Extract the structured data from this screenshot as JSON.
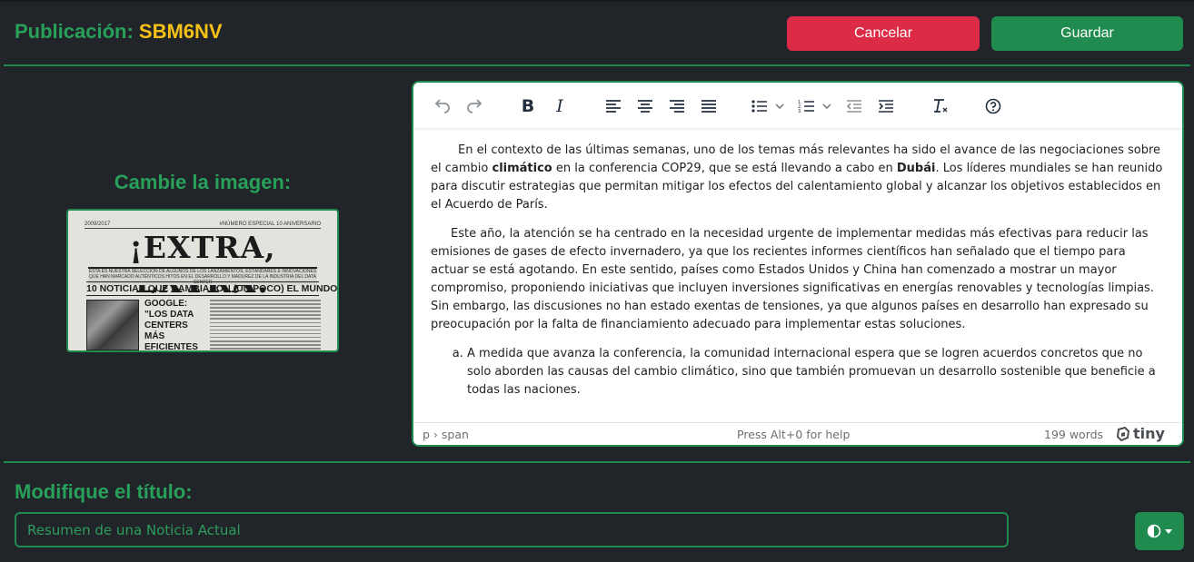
{
  "header": {
    "label": "Publicación:",
    "code": "SBM6NV",
    "cancel_label": "Cancelar",
    "save_label": "Guardar"
  },
  "image_section": {
    "label": "Cambie la imagen:",
    "newspaper": {
      "date": "2009/2017",
      "edition": "#NÚMERO ESPECIAL 10 ANIVERSARIO",
      "headline": "¡EXTRA, EXTRA!",
      "subheadline": "ESTA ES NUESTRA SELECCIÓN DE ALGUNOS DE LOS LANZAMIENTOS, ESTÁNDARES E INNOVACIONES QUE HAN MARCADO AUTÉNTICOS HITOS EN EL DESARROLLO Y MADUREZ DE LA INDUSTRIA DEL DATA CENTER",
      "banner": "10 NOTICIAS QUE CAMBIARON (UN POCO) EL MUNDO",
      "story": "GOOGLE: \"LOS DATA CENTERS MÁS EFICIENTES DEL GLOBO\""
    }
  },
  "editor": {
    "toolbar": {
      "icons": [
        "undo-icon",
        "redo-icon",
        "bold-icon",
        "italic-icon",
        "align-left-icon",
        "align-center-icon",
        "align-right-icon",
        "align-justify-icon",
        "bullet-list-icon",
        "numbered-list-icon",
        "outdent-icon",
        "indent-icon",
        "clear-formatting-icon",
        "help-icon"
      ]
    },
    "paragraph1": {
      "part1": "En el contexto de las últimas semanas, uno de los temas más relevantes ha sido el avance de las negociaciones sobre el cambio ",
      "bold1": "climático",
      "part2": " en la conferencia COP29, que se está llevando a cabo en ",
      "bold2": "Dubái",
      "part3": ". Los líderes mundiales se han reunido para discutir estrategias que permitan mitigar los efectos del calentamiento global y alcanzar los objetivos establecidos en el Acuerdo de París."
    },
    "paragraph2": "Este año, la atención se ha centrado en la necesidad urgente de implementar medidas más efectivas para reducir las emisiones de gases de efecto invernadero, ya que los recientes informes científicos han señalado que el tiempo para actuar se está agotando. En este sentido, países como Estados Unidos y China han comenzado a mostrar un mayor compromiso, proponiendo iniciativas que incluyen inversiones significativas en energías renovables y tecnologías limpias. Sin embargo, las discusiones no han estado exentas de tensiones, ya que algunos países en desarrollo han expresado su preocupación por la falta de financiamiento adecuado para implementar estas soluciones.",
    "list_items": [
      "A medida que avanza la conferencia, la comunidad internacional espera que se logren acuerdos concretos que no solo aborden las causas del cambio climático, sino que también promuevan un desarrollo sostenible que beneficie a todas las naciones."
    ],
    "status": {
      "path": "p › span",
      "help": "Press Alt+0 for help",
      "words": "199 words",
      "brand": "tiny"
    }
  },
  "title_section": {
    "label": "Modifique el título:",
    "placeholder": "Resumen de una Noticia Actual"
  },
  "theme_toggle": {
    "icon": "contrast-icon"
  },
  "colors": {
    "background": "#212529",
    "accent_green": "#28a05a",
    "code_yellow": "#f5c116",
    "cancel_red": "#dc2b47",
    "save_green": "#1f8b4f"
  }
}
